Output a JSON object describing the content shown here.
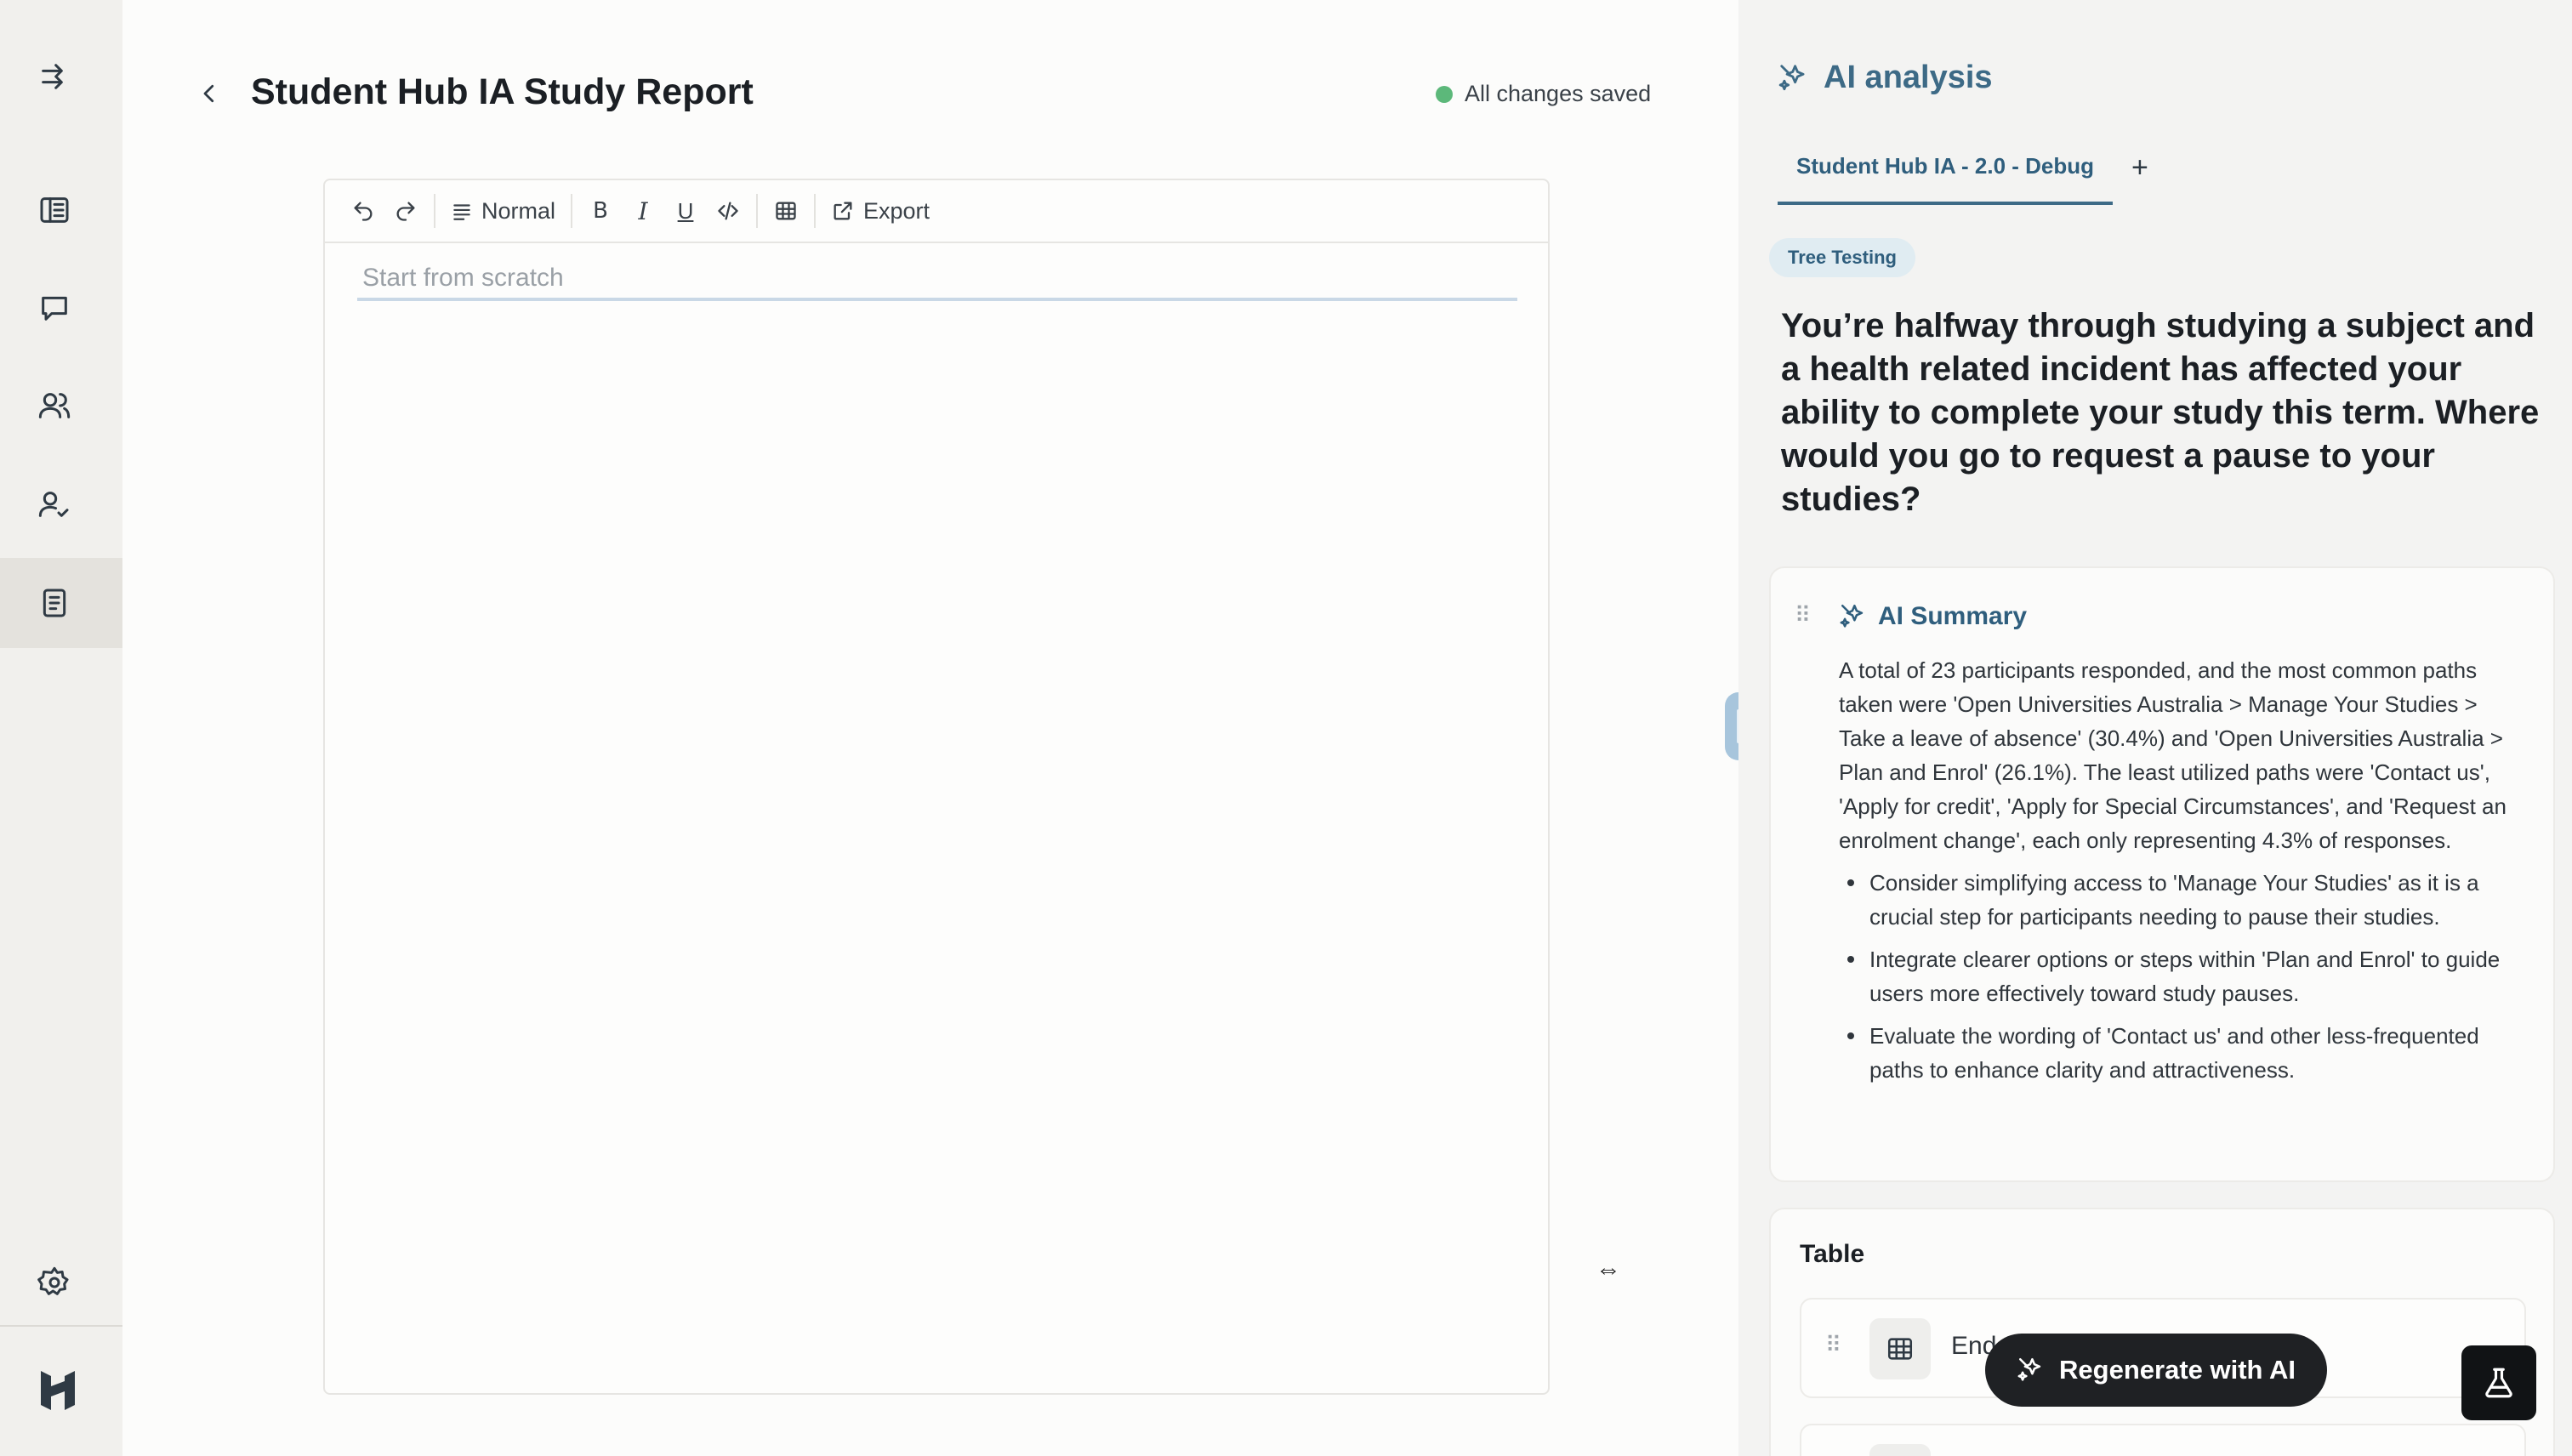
{
  "page": {
    "title": "Student Hub IA Study Report",
    "save_status": "All changes saved"
  },
  "rail": {
    "icons": [
      "expand-arrow-icon",
      "sidebar-panel-icon",
      "chat-bubble-icon",
      "users-icon",
      "user-check-icon",
      "report-doc-icon",
      "settings-gear-icon",
      "brand-logo-icon"
    ],
    "active": "report-doc-icon"
  },
  "toolbar": {
    "undo": "undo-icon",
    "redo": "redo-icon",
    "style_label": "Normal",
    "bold": "B",
    "italic": "I",
    "underline": "U",
    "export_label": "Export"
  },
  "editor": {
    "placeholder": "Start from scratch",
    "value": ""
  },
  "panel": {
    "title": "AI analysis",
    "tabs": [
      {
        "label": "Student Hub IA - 2.0 - Debug",
        "active": true
      }
    ],
    "badge": "Tree Testing",
    "question": "You’re halfway through studying a subject and a health related incident has affected your ability to complete your study this term. Where would you go to request a pause to your studies?",
    "summary": {
      "title": "AI Summary",
      "paragraph": "A total of 23 participants responded, and the most common paths taken were 'Open Universities Australia > Manage Your Studies > Take a leave of absence' (30.4%) and 'Open Universities Australia > Plan and Enrol' (26.1%). The least utilized paths were 'Contact us', 'Apply for credit', 'Apply for Special Circumstances', and 'Request an enrolment change', each only representing 4.3% of responses.",
      "bullets": [
        "Consider simplifying access to 'Manage Your Studies' as it is a crucial step for participants needing to pause their studies.",
        "Integrate clearer options or steps within 'Plan and Enrol' to guide users more effectively toward study pauses.",
        "Evaluate the wording of 'Contact us' and other less-frequented paths to enhance clarity and attractiveness."
      ]
    },
    "table": {
      "title": "Table",
      "items": [
        {
          "label": "End"
        }
      ]
    },
    "regenerate_label": "Regenerate with AI"
  },
  "colors": {
    "accent": "#3d6a86",
    "saved_dot": "#5cb87a",
    "rail_bg": "#f1f0ed",
    "panel_bg": "#f3f3f2"
  }
}
